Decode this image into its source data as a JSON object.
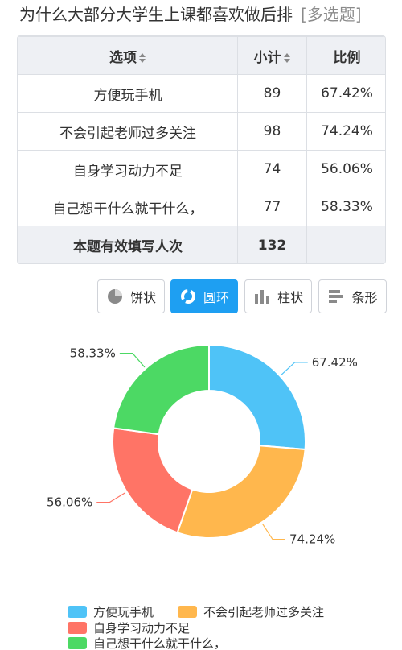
{
  "question": {
    "title": "为什么大部分大学生上课都喜欢做后排",
    "tag": "[多选题]"
  },
  "table": {
    "headers": [
      "选项",
      "小计",
      "比例"
    ],
    "rows": [
      {
        "option": "方便玩手机",
        "count": "89",
        "ratio": "67.42%"
      },
      {
        "option": "不会引起老师过多关注",
        "count": "98",
        "ratio": "74.24%"
      },
      {
        "option": "自身学习动力不足",
        "count": "74",
        "ratio": "56.06%"
      },
      {
        "option": "自己想干什么就干什么，",
        "count": "77",
        "ratio": "58.33%"
      }
    ],
    "summary": {
      "label": "本题有效填写人次",
      "count": "132",
      "ratio": ""
    }
  },
  "chart_buttons": [
    {
      "label": "饼状",
      "icon": "pie-chart-icon",
      "active": false
    },
    {
      "label": "圆环",
      "icon": "donut-chart-icon",
      "active": true
    },
    {
      "label": "柱状",
      "icon": "bar-chart-icon",
      "active": false
    },
    {
      "label": "条形",
      "icon": "horizontal-bar-icon",
      "active": false
    }
  ],
  "chart_data": {
    "type": "pie",
    "subtype": "donut",
    "categories": [
      "方便玩手机",
      "不会引起老师过多关注",
      "自身学习动力不足",
      "自己想干什么就干什么，"
    ],
    "values": [
      89,
      98,
      74,
      77
    ],
    "labels": [
      "67.42%",
      "74.24%",
      "56.06%",
      "58.33%"
    ],
    "colors": [
      "#4fc3f7",
      "#ffb74d",
      "#ff7466",
      "#4cd964"
    ],
    "legend_position": "bottom"
  }
}
